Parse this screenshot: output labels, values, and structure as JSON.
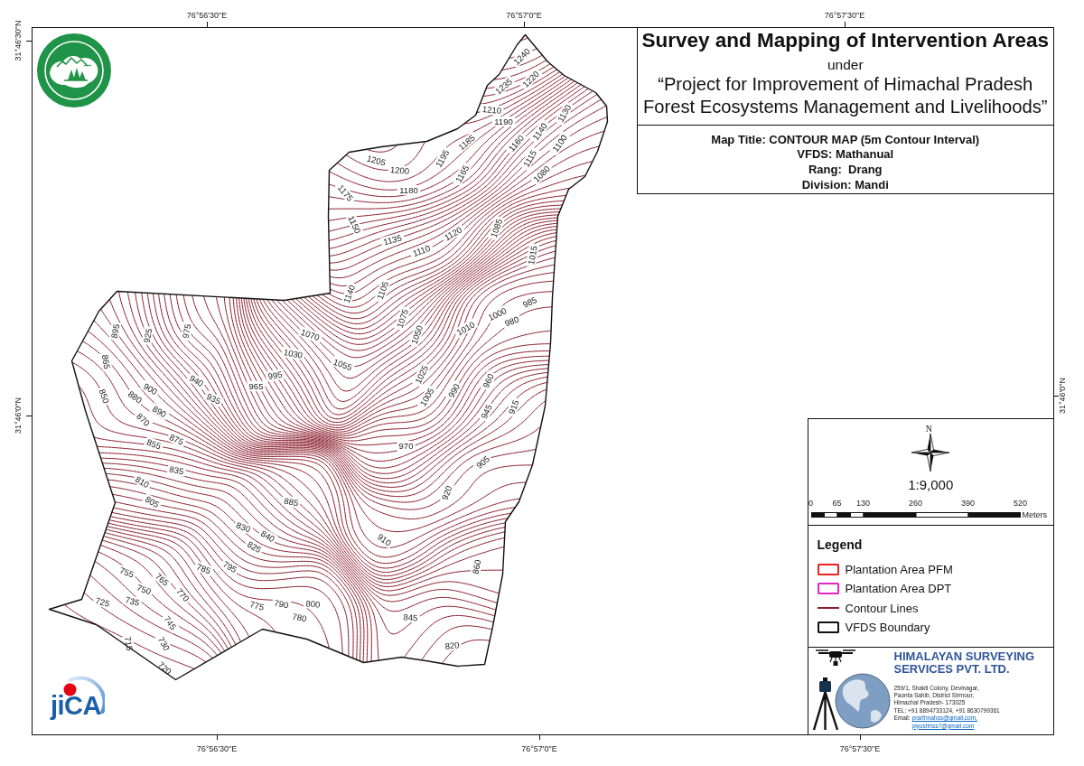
{
  "graticule": {
    "top": [
      "76°56'30\"E",
      "76°57'0\"E",
      "76°57'30\"E"
    ],
    "bottom": [
      "76°56'30\"E",
      "76°57'0\"E",
      "76°57'30\"E"
    ],
    "left": [
      "31°46'30\"N",
      "31°46'0\"N"
    ],
    "right": [
      "31°46'0\"N"
    ]
  },
  "map": {
    "contour_labels": [
      "1240",
      "1235",
      "1220",
      "1210",
      "1190",
      "1130",
      "1140",
      "1160",
      "1100",
      "1185",
      "1195",
      "1205",
      "1200",
      "1115",
      "1080",
      "1165",
      "1180",
      "1175",
      "1150",
      "1135",
      "1120",
      "1110",
      "1085",
      "1015",
      "1140",
      "1105",
      "1075",
      "1050",
      "1010",
      "1000",
      "985",
      "980",
      "895",
      "925",
      "975",
      "1070",
      "1030",
      "1055",
      "865",
      "995",
      "965",
      "940",
      "935",
      "1025",
      "1005",
      "990",
      "960",
      "850",
      "880",
      "900",
      "890",
      "870",
      "945",
      "915",
      "875",
      "855",
      "970",
      "835",
      "905",
      "810",
      "805",
      "885",
      "920",
      "830",
      "840",
      "825",
      "910",
      "860",
      "755",
      "765",
      "785",
      "795",
      "750",
      "770",
      "725",
      "735",
      "775",
      "790",
      "800",
      "780",
      "845",
      "745",
      "730",
      "715",
      "820",
      "720"
    ]
  },
  "title_block": {
    "title": "Survey and Mapping of Intervention Areas",
    "subtitle": "under",
    "project_lines": [
      "“Project for Improvement of Himachal Pradesh",
      "Forest Ecosystems Management and Livelihoods”"
    ],
    "details": [
      "Map Title: CONTOUR MAP (5m Contour Interval)",
      "VFDS: Mathanual",
      "Rang:  Drang",
      "Division: Mandi"
    ]
  },
  "north_arrow": {
    "label": "N"
  },
  "scale": {
    "ratio": "1:9,000",
    "ticks": [
      "0",
      "65",
      "130",
      "260",
      "390",
      "520"
    ],
    "unit": "Meters"
  },
  "legend": {
    "title": "Legend",
    "items": [
      {
        "kind": "area",
        "color": "#e8261f",
        "label": "Plantation Area PFM"
      },
      {
        "kind": "area",
        "color": "#e626c4",
        "label": "Plantation Area DPT"
      },
      {
        "kind": "line",
        "color": "#8b1e2e",
        "label": "Contour Lines"
      },
      {
        "kind": "area",
        "color": "#111111",
        "label": "VFDS Boundary"
      }
    ]
  },
  "company": {
    "name_lines": [
      "HIMALAYAN SURVEYING",
      "SERVICES PVT. LTD."
    ],
    "address_lines": [
      "259/1, Shakti Colony, Devinagar,",
      "Paonta Sahib, District Sirmour,",
      "Himachal Pradesh- 173025"
    ],
    "phone": "TEL: +91 8894733124, +91 8630799361",
    "email_label": "Email:",
    "emails": [
      "prarthnahss@gmail.com,",
      "piyushhss7@gmail.com"
    ]
  },
  "jica_logo": {
    "wordmark": "jiCA"
  }
}
